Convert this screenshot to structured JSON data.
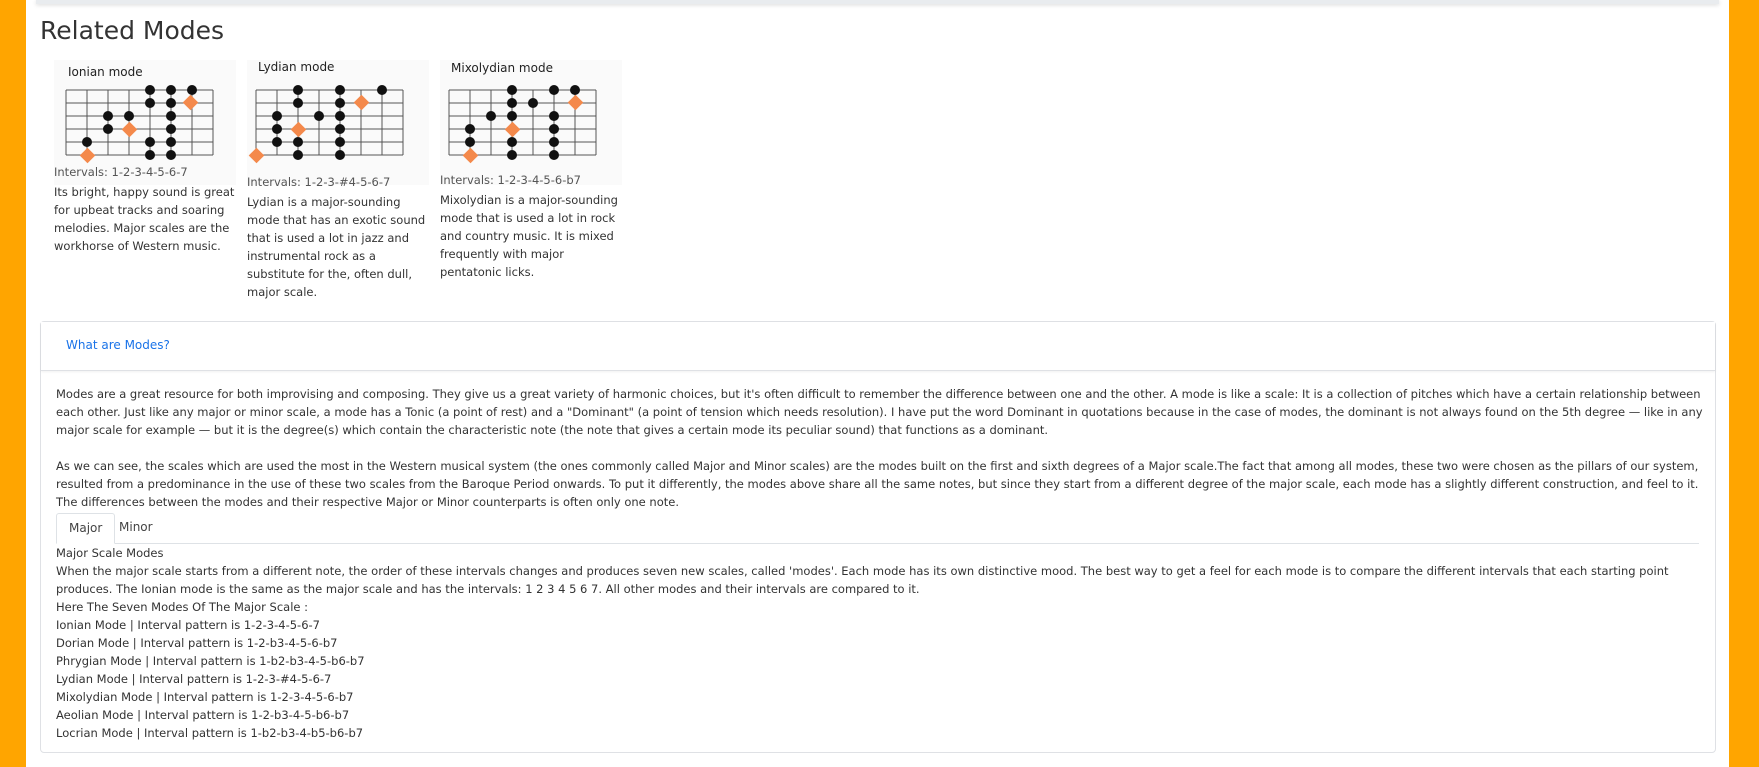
{
  "section_title": "Related Modes",
  "cards": [
    {
      "title": "Ionian mode",
      "intervals": "Intervals: 1-2-3-4-5-6-7",
      "description": "Its bright, happy sound is great for upbeat tracks and soaring melodies. Major scales are the workhorse of Western music."
    },
    {
      "title": "Lydian mode",
      "intervals": "Intervals: 1-2-3-#4-5-6-7",
      "description": "Lydian is a major-sounding mode that has an exotic sound that is used a lot in jazz and instrumental rock as a substitute for the, often dull, major scale."
    },
    {
      "title": "Mixolydian mode",
      "intervals": "Intervals: 1-2-3-4-5-6-b7",
      "description": "Mixolydian is a major-sounding mode that is used a lot in rock and country music. It is mixed frequently with major pentatonic licks."
    }
  ],
  "panel": {
    "header_link": "What are Modes?",
    "paragraph1": "Modes are a great resource for both improvising and composing. They give us a great variety of harmonic choices, but it's often difficult to remember the difference between one and the other. A mode is like a scale: It is a collection of pitches which have a certain relationship between each other. Just like any major or minor scale, a mode has a Tonic (a point of rest) and a \"Dominant\" (a point of tension which needs resolution). I have put the word Dominant in quotations because in the case of modes, the dominant is not always found on the 5th degree — like in any major scale for example — but it is the degree(s) which contain the characteristic note (the note that gives a certain mode its peculiar sound) that functions as a dominant.",
    "paragraph2": "As we can see, the scales which are used the most in the Western musical system (the ones commonly called Major and Minor scales) are the modes built on the first and sixth degrees of a Major scale.The fact that among all modes, these two were chosen as the pillars of our system, resulted from a predominance in the use of these two scales from the Baroque Period onwards. To put it differently, the modes above share all the same notes, but since they start from a different degree of the major scale, each mode has a slightly different construction, and feel to it. The differences between the modes and their respective Major or Minor counterparts is often only one note.",
    "tabs": [
      "Major",
      "Minor"
    ],
    "modes_title": "Major Scale Modes",
    "modes_intro": "When the major scale starts from a different note, the order of these intervals changes and produces seven new scales, called 'modes'. Each mode has its own distinctive mood. The best way to get a feel for each mode is to compare the different intervals that each starting point produces. The Ionian mode is the same as the major scale and has the intervals: 1 2 3 4 5 6 7. All other modes and their intervals are compared to it.",
    "modes_heading": "Here The Seven Modes Of The Major Scale :",
    "mode_lines": [
      "Ionian Mode | Interval pattern is 1-2-3-4-5-6-7",
      "Dorian Mode | Interval pattern is 1-2-b3-4-5-6-b7",
      "Phrygian Mode | Interval pattern is 1-b2-b3-4-5-b6-b7",
      "Lydian Mode | Interval pattern is 1-2-3-#4-5-6-7",
      "Mixolydian Mode | Interval pattern is 1-2-3-4-5-6-b7",
      "Aeolian Mode | Interval pattern is 1-2-b3-4-5-b6-b7",
      "Locrian Mode | Interval pattern is 1-b2-b3-4-b5-b6-b7"
    ]
  },
  "colors": {
    "background": "#ffa500",
    "root_marker": "#f4894b",
    "link": "#1a73e8"
  }
}
